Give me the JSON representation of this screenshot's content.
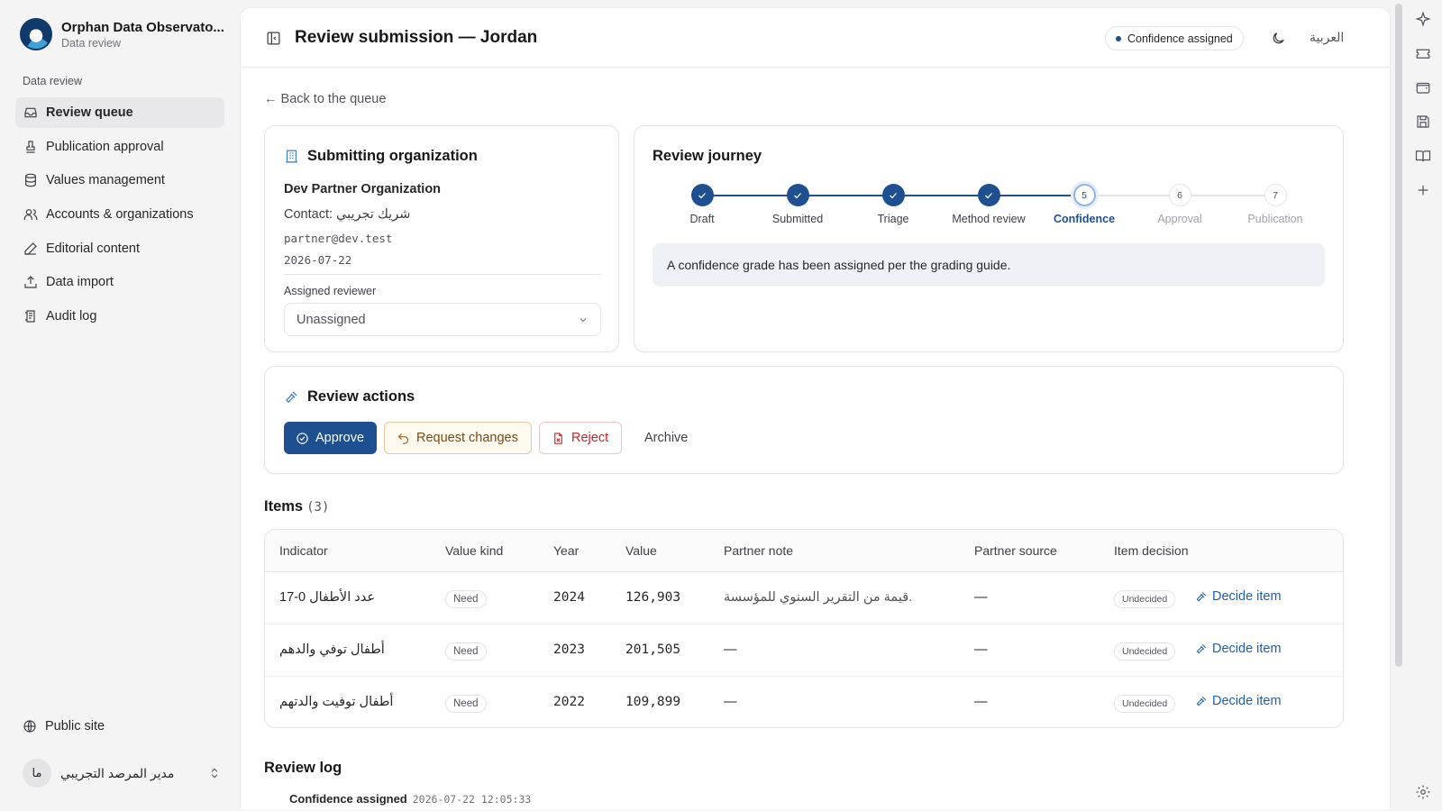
{
  "brand": {
    "title": "Orphan Data Observato...",
    "subtitle": "Data review"
  },
  "sidebar": {
    "section_label": "Data review",
    "items": [
      {
        "label": "Review queue",
        "icon": "inbox-icon",
        "active": true
      },
      {
        "label": "Publication approval",
        "icon": "stamp-icon",
        "active": false
      },
      {
        "label": "Values management",
        "icon": "database-icon",
        "active": false
      },
      {
        "label": "Accounts & organizations",
        "icon": "users-icon",
        "active": false
      },
      {
        "label": "Editorial content",
        "icon": "pen-icon",
        "active": false
      },
      {
        "label": "Data import",
        "icon": "upload-icon",
        "active": false
      },
      {
        "label": "Audit log",
        "icon": "log-icon",
        "active": false
      }
    ],
    "public_site": "Public site",
    "user": {
      "avatar": "ما",
      "name": "مدير المرصد التجريبي"
    }
  },
  "header": {
    "title": "Review submission — Jordan",
    "status": "Confidence assigned",
    "language": "العربية"
  },
  "back_link": "← Back to the queue",
  "organization": {
    "title": "Submitting organization",
    "name": "Dev Partner Organization",
    "contact": "Contact: شريك تجريبي",
    "email": "partner@dev.test",
    "date": "2026-07-22",
    "reviewer_label": "Assigned reviewer",
    "reviewer_value": "Unassigned"
  },
  "journey": {
    "title": "Review journey",
    "steps": [
      {
        "label": "Draft",
        "number": "1",
        "state": "done"
      },
      {
        "label": "Submitted",
        "number": "2",
        "state": "done"
      },
      {
        "label": "Triage",
        "number": "3",
        "state": "done"
      },
      {
        "label": "Method review",
        "number": "4",
        "state": "done"
      },
      {
        "label": "Confidence",
        "number": "5",
        "state": "current"
      },
      {
        "label": "Approval",
        "number": "6",
        "state": "todo"
      },
      {
        "label": "Publication",
        "number": "7",
        "state": "todo"
      }
    ],
    "note": "A confidence grade has been assigned per the grading guide."
  },
  "actions": {
    "title": "Review actions",
    "approve": "Approve",
    "request_changes": "Request changes",
    "reject": "Reject",
    "archive": "Archive"
  },
  "items": {
    "title": "Items",
    "count": "(3)",
    "columns": [
      "Indicator",
      "Value kind",
      "Year",
      "Value",
      "Partner note",
      "Partner source",
      "Item decision"
    ],
    "rows": [
      {
        "indicator": "عدد الأطفال 0-17",
        "kind": "Need",
        "year": "2024",
        "value": "126,903",
        "note": "قيمة من التقرير السنوي للمؤسسة.",
        "source": "—",
        "decision": "Undecided",
        "action": "Decide item"
      },
      {
        "indicator": "أطفال توفي والدهم",
        "kind": "Need",
        "year": "2023",
        "value": "201,505",
        "note": "—",
        "source": "—",
        "decision": "Undecided",
        "action": "Decide item"
      },
      {
        "indicator": "أطفال توفيت والدتهم",
        "kind": "Need",
        "year": "2022",
        "value": "109,899",
        "note": "—",
        "source": "—",
        "decision": "Undecided",
        "action": "Decide item"
      }
    ]
  },
  "review_log": {
    "title": "Review log",
    "entry_title": "Confidence assigned",
    "entry_time": "2026-07-22 12:05:33"
  },
  "colors": {
    "primary": "#1d4f91",
    "link": "#1d5fa8",
    "reject": "#c0262d",
    "changes": "#7a4a12"
  }
}
